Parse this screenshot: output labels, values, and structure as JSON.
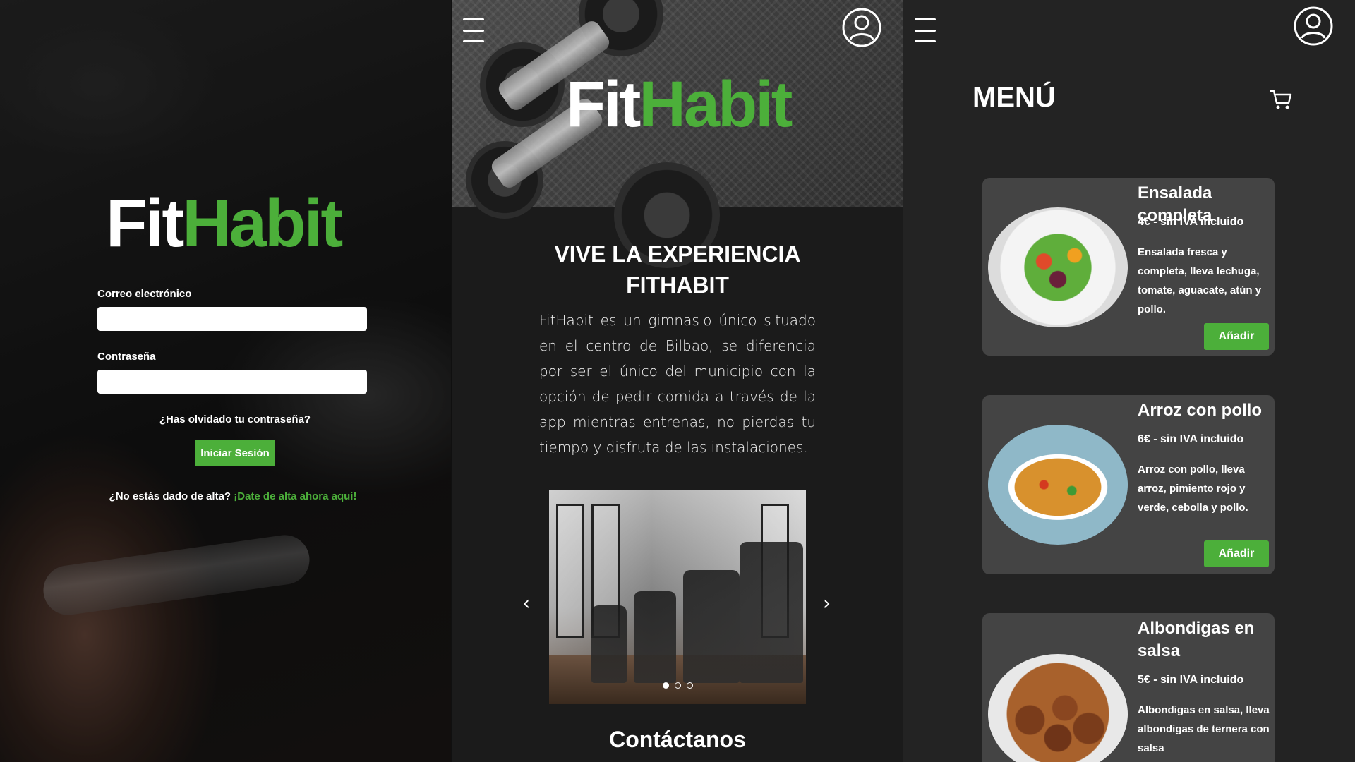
{
  "brand": {
    "fit": "Fit",
    "habit": "Habit",
    "accent": "#4caf3a"
  },
  "login": {
    "email_label": "Correo electrónico",
    "password_label": "Contraseña",
    "forgot": "¿Has olvidado tu contraseña?",
    "submit": "Iniciar Sesión",
    "signup_prompt": "¿No estás dado de alta?",
    "signup_link": "¡Date de alta ahora aquí!"
  },
  "home": {
    "title_line1": "VIVE LA EXPERIENCIA",
    "title_line2": "FITHABIT",
    "description": "FitHabit es un gimnasio único situado en el centro de Bilbao, se diferencia por ser el único del municipio con la opción de pedir comida a través de la app mientras entrenas, no pierdas tu tiempo y disfruta de las instalaciones.",
    "prev": "‹",
    "next": "›",
    "contact": "Contáctanos",
    "carousel_slides": 3,
    "carousel_active": 1
  },
  "menu": {
    "title": "MENÚ",
    "add_label": "Añadir",
    "items": [
      {
        "name": "Ensalada completa",
        "price": "4€ - sin IVA incluido",
        "desc": "Ensalada fresca y completa, lleva lechuga, tomate, aguacate, atún y pollo."
      },
      {
        "name": "Arroz con pollo",
        "price": "6€ - sin IVA incluido",
        "desc": "Arroz con pollo, lleva arroz, pimiento rojo y verde, cebolla y pollo."
      },
      {
        "name": "Albondigas en salsa",
        "price": "5€ - sin IVA incluido",
        "desc": "Albondigas en salsa, lleva albondigas de ternera con salsa"
      }
    ]
  },
  "icons": [
    "hamburger-menu-icon",
    "user-profile-icon",
    "shopping-cart-icon"
  ]
}
